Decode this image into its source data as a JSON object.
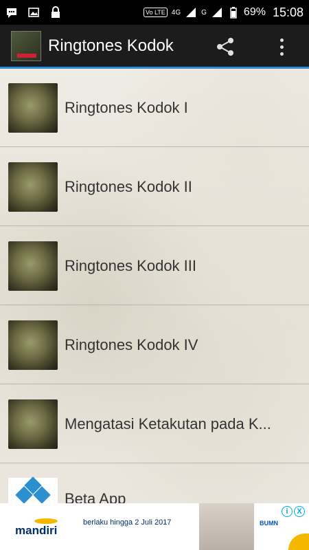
{
  "status_bar": {
    "icons": [
      "messages-icon",
      "image-icon",
      "lock-icon"
    ],
    "volte": "Vo LTE",
    "network_1": "4G",
    "network_2": "G",
    "battery": "69%",
    "time": "15:08"
  },
  "app_bar": {
    "title": "Ringtones Kodok",
    "share_icon": "share-icon",
    "menu_icon": "overflow-menu-icon"
  },
  "list": {
    "items": [
      {
        "label": "Ringtones Kodok I"
      },
      {
        "label": "Ringtones Kodok II"
      },
      {
        "label": "Ringtones Kodok III"
      },
      {
        "label": "Ringtones Kodok IV"
      },
      {
        "label": "Mengatasi Ketakutan pada K..."
      },
      {
        "label": "Beta App"
      }
    ]
  },
  "ad": {
    "brand": "mandiri",
    "text": "berlaku hingga 2 Juli 2017",
    "partner": "BUMN",
    "choices": [
      "i",
      "X"
    ]
  },
  "colors": {
    "accent": "#2a8fd6",
    "app_bar": "#1c1c1c",
    "text": "#333333"
  }
}
